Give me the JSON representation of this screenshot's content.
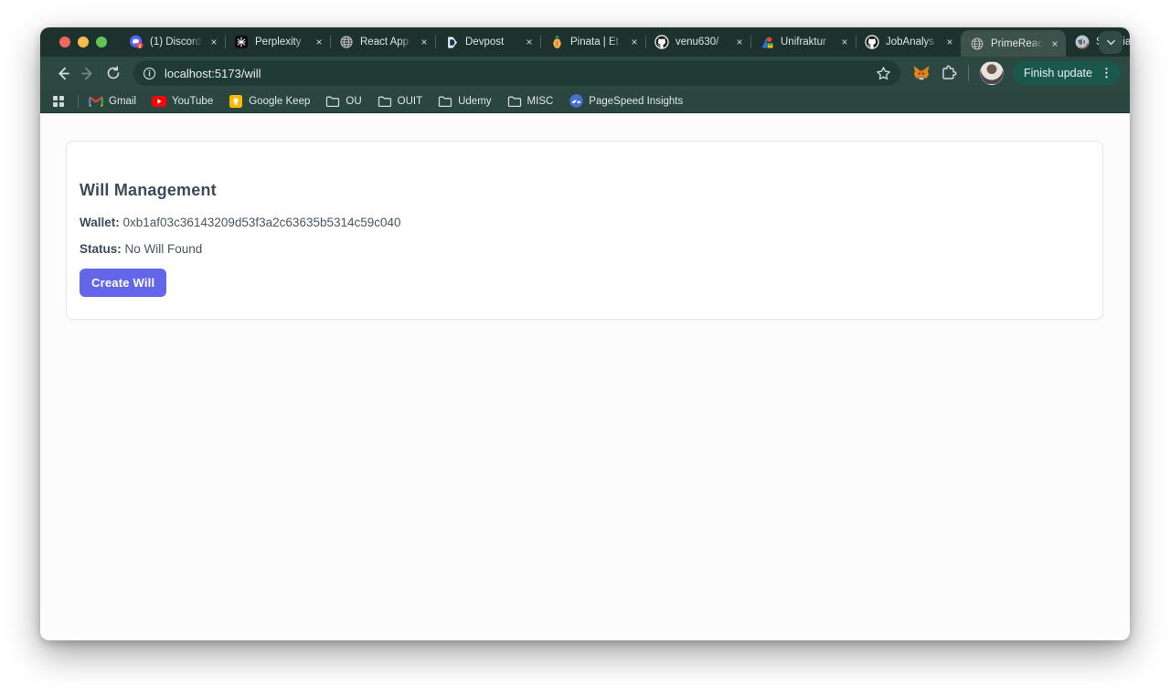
{
  "tab_strip": {
    "tabs": [
      {
        "title": "(1) Discord",
        "icon": "discord-icon",
        "active": false
      },
      {
        "title": "Perplexity",
        "icon": "perplexity-icon",
        "active": false
      },
      {
        "title": "React App",
        "icon": "globe-icon",
        "active": false
      },
      {
        "title": "Devpost",
        "icon": "devpost-icon",
        "active": false
      },
      {
        "title": "Pinata | Et",
        "icon": "pinata-icon",
        "active": false
      },
      {
        "title": "venu630/",
        "icon": "github-icon",
        "active": false
      },
      {
        "title": "Unifraktur",
        "icon": "google-fonts-icon",
        "active": false
      },
      {
        "title": "JobAnalys",
        "icon": "github-icon",
        "active": false
      },
      {
        "title": "PrimeReac",
        "icon": "globe-icon",
        "active": true
      },
      {
        "title": "Sepolia Tr",
        "icon": "etherscan-icon",
        "active": false
      }
    ],
    "new_tab_label": "+",
    "close_label": "×"
  },
  "toolbar": {
    "url": "localhost:5173/will",
    "update_button_label": "Finish update",
    "menu_dots": "⋮"
  },
  "bookmarks_bar": {
    "items": [
      {
        "label": "Gmail",
        "icon": "gmail-icon"
      },
      {
        "label": "YouTube",
        "icon": "youtube-icon"
      },
      {
        "label": "Google Keep",
        "icon": "keep-icon"
      },
      {
        "label": "OU",
        "icon": "folder-icon"
      },
      {
        "label": "OUIT",
        "icon": "folder-icon"
      },
      {
        "label": "Udemy",
        "icon": "folder-icon"
      },
      {
        "label": "MISC",
        "icon": "folder-icon"
      },
      {
        "label": "PageSpeed Insights",
        "icon": "pagespeed-icon"
      }
    ]
  },
  "content": {
    "title": "Will Management",
    "wallet_label": "Wallet:",
    "wallet_value": "0xb1af03c36143209d53f3a2c63635b5314c59c040",
    "status_label": "Status:",
    "status_value": "No Will Found",
    "create_will_label": "Create Will"
  },
  "colors": {
    "accent_purple": "#6466e9",
    "chrome_frame": "#1d322c",
    "chrome_toolbar": "#2c4841",
    "active_tab": "#3c524b",
    "update_pill": "#1a584e"
  }
}
